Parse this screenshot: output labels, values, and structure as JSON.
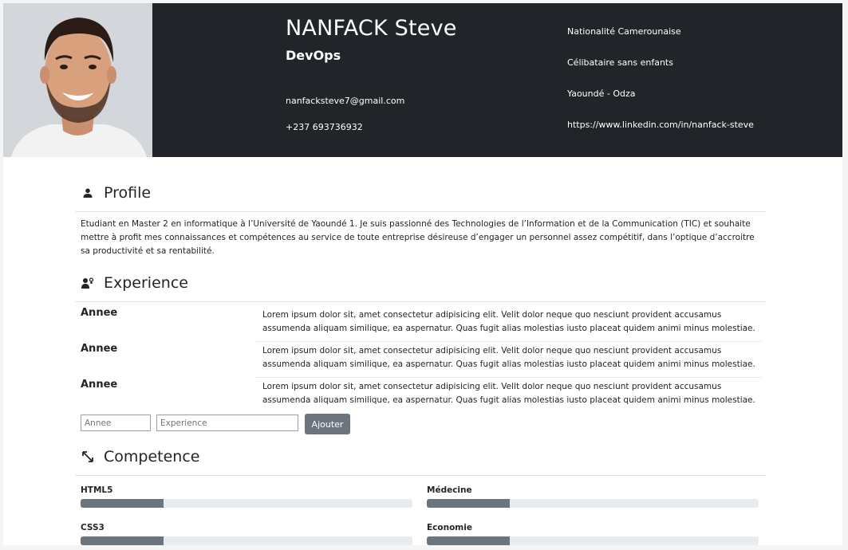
{
  "header": {
    "name": "NANFACK Steve",
    "role": "DevOps",
    "email": "nanfacksteve7@gmail.com",
    "phone": "+237 693736932",
    "nationality": "Nationalité Camerounaise",
    "status": "Célibataire sans enfants",
    "location": "Yaoundé - Odza",
    "linkedin": "https://www.linkedin.com/in/nanfack-steve"
  },
  "profile": {
    "title": "Profile",
    "text": "Etudiant en Master 2 en informatique à l’Université de Yaoundé 1. Je suis passionné des Technologies de l’Information et de la Communication (TIC) et souhaite mettre à profit mes connaissances et compétences au service de toute entreprise désireuse d’engager un personnel assez compétitif, dans l’optique d’accroitre sa productivité et sa rentabilité."
  },
  "experience": {
    "title": "Experience",
    "items": [
      {
        "year": "Annee",
        "description": "Lorem ipsum dolor sit, amet consectetur adipisicing elit. Velit dolor neque quo nesciunt provident accusamus assumenda aliquam similique, ea aspernatur. Quas fugit alias molestias iusto placeat quidem animi minus molestiae."
      },
      {
        "year": "Annee",
        "description": "Lorem ipsum dolor sit, amet consectetur adipisicing elit. Velit dolor neque quo nesciunt provident accusamus assumenda aliquam similique, ea aspernatur. Quas fugit alias molestias iusto placeat quidem animi minus molestiae."
      },
      {
        "year": "Annee",
        "description": "Lorem ipsum dolor sit, amet consectetur adipisicing elit. Velit dolor neque quo nesciunt provident accusamus assumenda aliquam similique, ea aspernatur. Quas fugit alias molestias iusto placeat quidem animi minus molestiae."
      }
    ],
    "form": {
      "year_placeholder": "Annee",
      "experience_placeholder": "Experience",
      "add_label": "Ajouter"
    }
  },
  "competence": {
    "title": "Competence",
    "skills": [
      {
        "name": "HTML5",
        "level": 0.25
      },
      {
        "name": "Médecine",
        "level": 0.25
      },
      {
        "name": "CSS3",
        "level": 0.25
      },
      {
        "name": "Economie",
        "level": 0.25
      }
    ]
  },
  "colors": {
    "header_bg": "#212529",
    "progress_fill": "#6c757d",
    "progress_track": "#e9ecef",
    "button_bg": "#6c757d"
  },
  "icons": {
    "profile": "person-icon",
    "experience": "user-graduate-icon",
    "competence": "arrows-diagonal-icon"
  }
}
